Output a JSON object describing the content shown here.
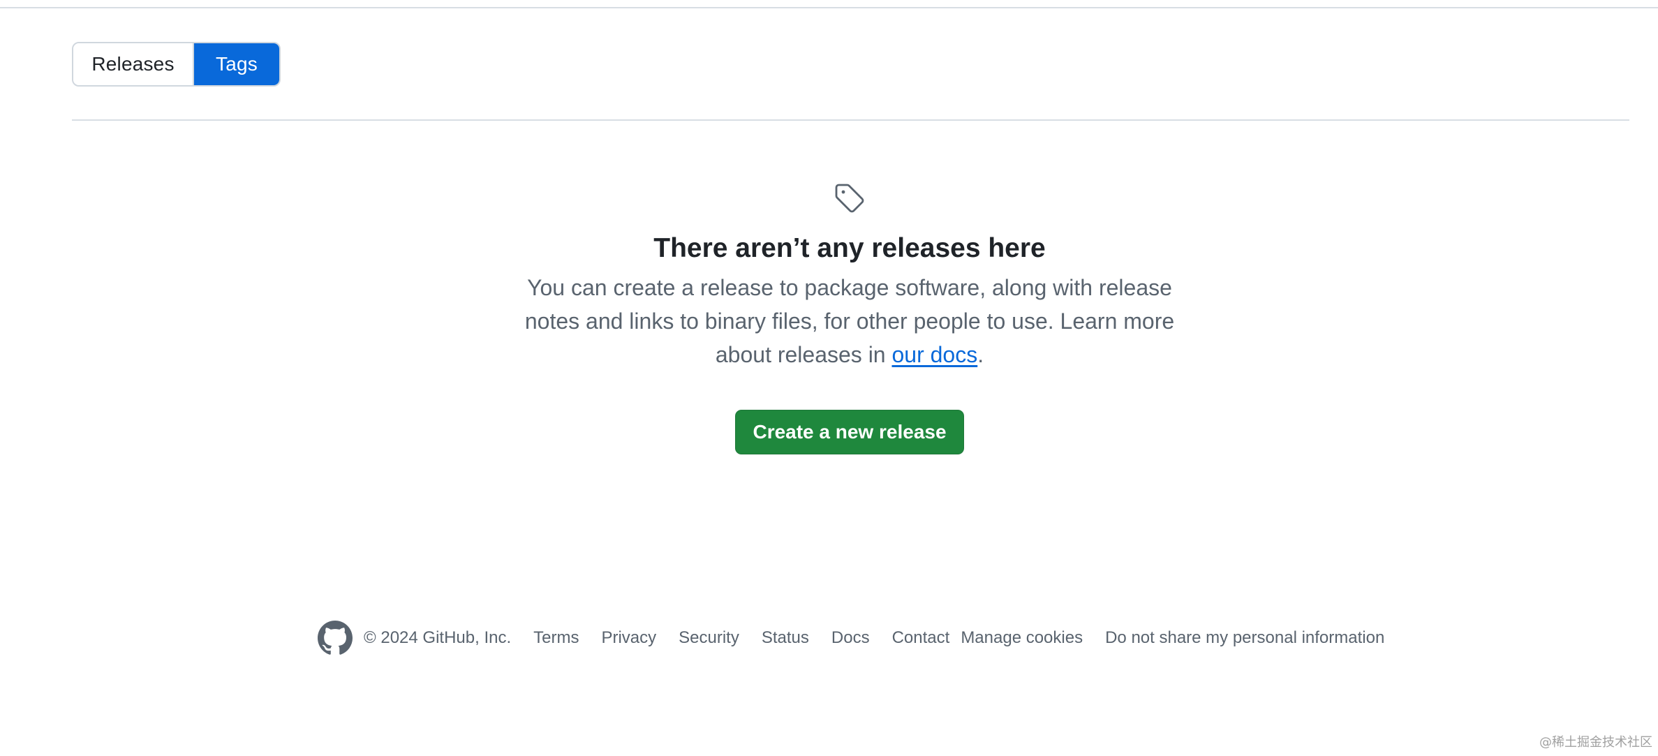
{
  "tabs": {
    "releases": "Releases",
    "tags": "Tags",
    "active": "Tags"
  },
  "blankslate": {
    "icon": "tag-icon",
    "title": "There aren’t any releases here",
    "desc_before": "You can create a release to package software, along with release notes and links to binary files, for other people to use. Learn more about releases in ",
    "docs_link": "our docs",
    "desc_after": ".",
    "create_button": "Create a new release"
  },
  "footer": {
    "logo": "github-logo-icon",
    "copyright": "© 2024 GitHub, Inc.",
    "links": [
      "Terms",
      "Privacy",
      "Security",
      "Status",
      "Docs",
      "Contact",
      "Manage cookies",
      "Do not share my personal information"
    ]
  },
  "watermark": "@稀土掘金技术社区",
  "colors": {
    "accent": "#0969da",
    "primary_button": "#1f883d",
    "muted_text": "#59636e"
  }
}
